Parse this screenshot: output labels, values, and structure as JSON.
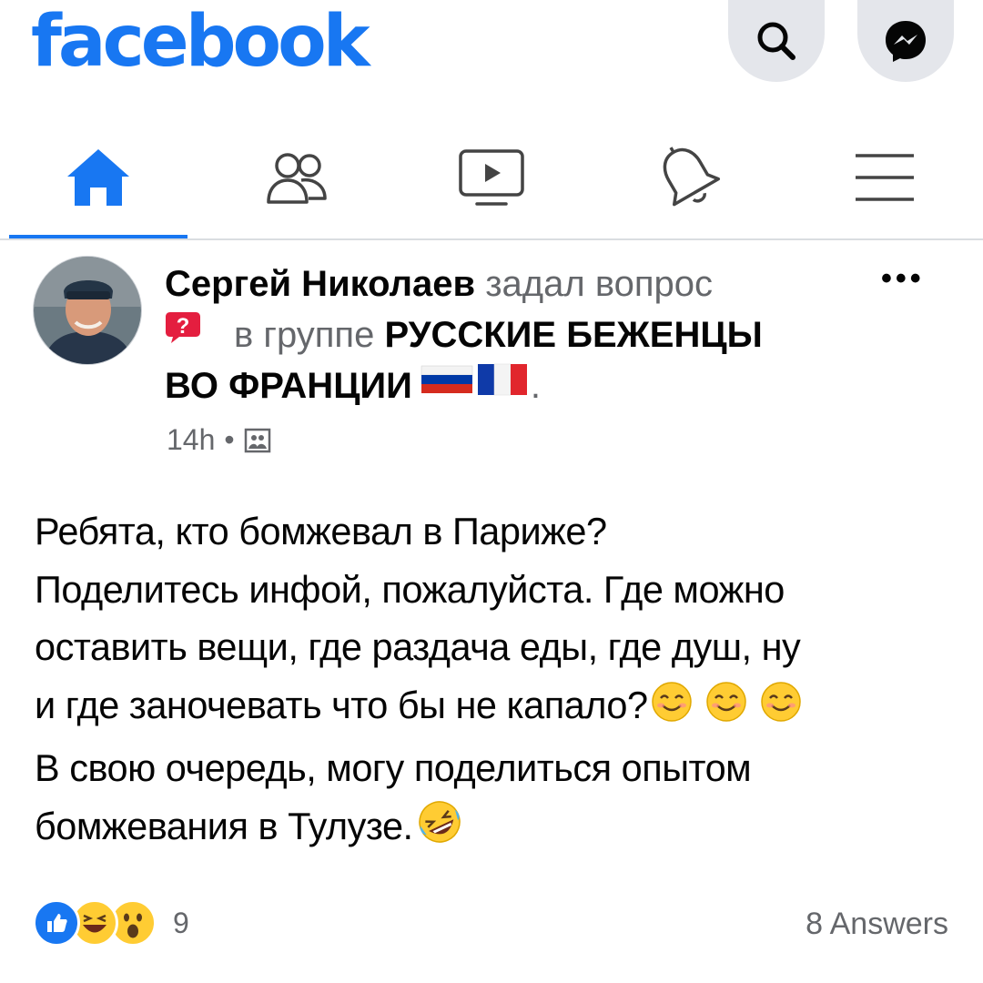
{
  "header": {
    "logo": "facebook",
    "icons": [
      "search-icon",
      "messenger-icon"
    ]
  },
  "nav": {
    "tabs": [
      {
        "icon": "home-icon",
        "active": true
      },
      {
        "icon": "friends-icon",
        "active": false
      },
      {
        "icon": "watch-icon",
        "active": false
      },
      {
        "icon": "bell-icon",
        "active": false
      },
      {
        "icon": "menu-icon",
        "active": false
      }
    ]
  },
  "post": {
    "author": "Сергей Николаев",
    "action": "задал вопрос",
    "in_group": "в группе",
    "group_line1": "РУССКИЕ БЕЖЕНЦЫ",
    "group_line2": "ВО ФРАНЦИИ",
    "group_suffix": ".",
    "time": "14h",
    "separator": "•",
    "privacy_icon": "group-privacy-icon",
    "more_label": "•••",
    "text_lines": [
      "Ребята, кто бомжевал в Париже?",
      "Поделитесь инфой, пожалуйста. Где можно",
      "оставить вещи, где раздача еды, где душ, ну",
      "и где заночевать что бы не капало?",
      "В свою очередь, могу поделиться опытом",
      "бомжевания в Тулузе."
    ],
    "reactions": [
      "like",
      "haha",
      "wow"
    ],
    "reaction_count": "9",
    "answers": "8 Answers"
  },
  "colors": {
    "brand": "#1877f2",
    "muted": "#65676b",
    "button_bg": "#e4e6eb"
  }
}
